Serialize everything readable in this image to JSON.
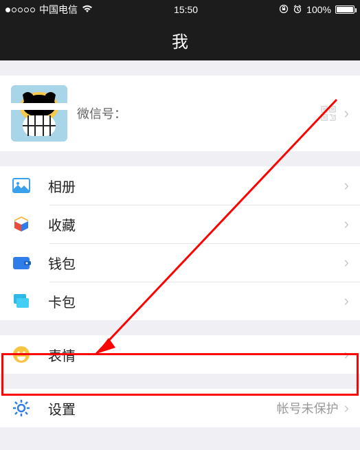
{
  "statusbar": {
    "carrier": "中国电信",
    "time": "15:50",
    "battery_pct": "100%"
  },
  "nav": {
    "title": "我"
  },
  "profile": {
    "wx_prefix": "微信号："
  },
  "menu": {
    "album": "相册",
    "favorites": "收藏",
    "wallet": "钱包",
    "cards": "卡包",
    "stickers": "表情",
    "settings": "设置",
    "settings_note": "帐号未保护"
  }
}
